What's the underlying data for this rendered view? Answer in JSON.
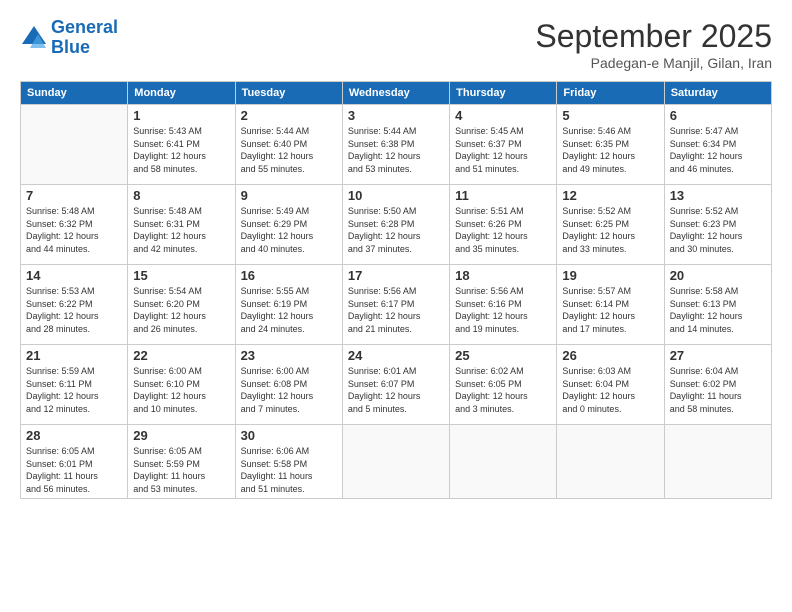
{
  "header": {
    "logo_line1": "General",
    "logo_line2": "Blue",
    "title": "September 2025",
    "subtitle": "Padegan-e Manjil, Gilan, Iran"
  },
  "days": [
    "Sunday",
    "Monday",
    "Tuesday",
    "Wednesday",
    "Thursday",
    "Friday",
    "Saturday"
  ],
  "weeks": [
    [
      {
        "day": "",
        "info": ""
      },
      {
        "day": "1",
        "info": "Sunrise: 5:43 AM\nSunset: 6:41 PM\nDaylight: 12 hours\nand 58 minutes."
      },
      {
        "day": "2",
        "info": "Sunrise: 5:44 AM\nSunset: 6:40 PM\nDaylight: 12 hours\nand 55 minutes."
      },
      {
        "day": "3",
        "info": "Sunrise: 5:44 AM\nSunset: 6:38 PM\nDaylight: 12 hours\nand 53 minutes."
      },
      {
        "day": "4",
        "info": "Sunrise: 5:45 AM\nSunset: 6:37 PM\nDaylight: 12 hours\nand 51 minutes."
      },
      {
        "day": "5",
        "info": "Sunrise: 5:46 AM\nSunset: 6:35 PM\nDaylight: 12 hours\nand 49 minutes."
      },
      {
        "day": "6",
        "info": "Sunrise: 5:47 AM\nSunset: 6:34 PM\nDaylight: 12 hours\nand 46 minutes."
      }
    ],
    [
      {
        "day": "7",
        "info": "Sunrise: 5:48 AM\nSunset: 6:32 PM\nDaylight: 12 hours\nand 44 minutes."
      },
      {
        "day": "8",
        "info": "Sunrise: 5:48 AM\nSunset: 6:31 PM\nDaylight: 12 hours\nand 42 minutes."
      },
      {
        "day": "9",
        "info": "Sunrise: 5:49 AM\nSunset: 6:29 PM\nDaylight: 12 hours\nand 40 minutes."
      },
      {
        "day": "10",
        "info": "Sunrise: 5:50 AM\nSunset: 6:28 PM\nDaylight: 12 hours\nand 37 minutes."
      },
      {
        "day": "11",
        "info": "Sunrise: 5:51 AM\nSunset: 6:26 PM\nDaylight: 12 hours\nand 35 minutes."
      },
      {
        "day": "12",
        "info": "Sunrise: 5:52 AM\nSunset: 6:25 PM\nDaylight: 12 hours\nand 33 minutes."
      },
      {
        "day": "13",
        "info": "Sunrise: 5:52 AM\nSunset: 6:23 PM\nDaylight: 12 hours\nand 30 minutes."
      }
    ],
    [
      {
        "day": "14",
        "info": "Sunrise: 5:53 AM\nSunset: 6:22 PM\nDaylight: 12 hours\nand 28 minutes."
      },
      {
        "day": "15",
        "info": "Sunrise: 5:54 AM\nSunset: 6:20 PM\nDaylight: 12 hours\nand 26 minutes."
      },
      {
        "day": "16",
        "info": "Sunrise: 5:55 AM\nSunset: 6:19 PM\nDaylight: 12 hours\nand 24 minutes."
      },
      {
        "day": "17",
        "info": "Sunrise: 5:56 AM\nSunset: 6:17 PM\nDaylight: 12 hours\nand 21 minutes."
      },
      {
        "day": "18",
        "info": "Sunrise: 5:56 AM\nSunset: 6:16 PM\nDaylight: 12 hours\nand 19 minutes."
      },
      {
        "day": "19",
        "info": "Sunrise: 5:57 AM\nSunset: 6:14 PM\nDaylight: 12 hours\nand 17 minutes."
      },
      {
        "day": "20",
        "info": "Sunrise: 5:58 AM\nSunset: 6:13 PM\nDaylight: 12 hours\nand 14 minutes."
      }
    ],
    [
      {
        "day": "21",
        "info": "Sunrise: 5:59 AM\nSunset: 6:11 PM\nDaylight: 12 hours\nand 12 minutes."
      },
      {
        "day": "22",
        "info": "Sunrise: 6:00 AM\nSunset: 6:10 PM\nDaylight: 12 hours\nand 10 minutes."
      },
      {
        "day": "23",
        "info": "Sunrise: 6:00 AM\nSunset: 6:08 PM\nDaylight: 12 hours\nand 7 minutes."
      },
      {
        "day": "24",
        "info": "Sunrise: 6:01 AM\nSunset: 6:07 PM\nDaylight: 12 hours\nand 5 minutes."
      },
      {
        "day": "25",
        "info": "Sunrise: 6:02 AM\nSunset: 6:05 PM\nDaylight: 12 hours\nand 3 minutes."
      },
      {
        "day": "26",
        "info": "Sunrise: 6:03 AM\nSunset: 6:04 PM\nDaylight: 12 hours\nand 0 minutes."
      },
      {
        "day": "27",
        "info": "Sunrise: 6:04 AM\nSunset: 6:02 PM\nDaylight: 11 hours\nand 58 minutes."
      }
    ],
    [
      {
        "day": "28",
        "info": "Sunrise: 6:05 AM\nSunset: 6:01 PM\nDaylight: 11 hours\nand 56 minutes."
      },
      {
        "day": "29",
        "info": "Sunrise: 6:05 AM\nSunset: 5:59 PM\nDaylight: 11 hours\nand 53 minutes."
      },
      {
        "day": "30",
        "info": "Sunrise: 6:06 AM\nSunset: 5:58 PM\nDaylight: 11 hours\nand 51 minutes."
      },
      {
        "day": "",
        "info": ""
      },
      {
        "day": "",
        "info": ""
      },
      {
        "day": "",
        "info": ""
      },
      {
        "day": "",
        "info": ""
      }
    ]
  ]
}
